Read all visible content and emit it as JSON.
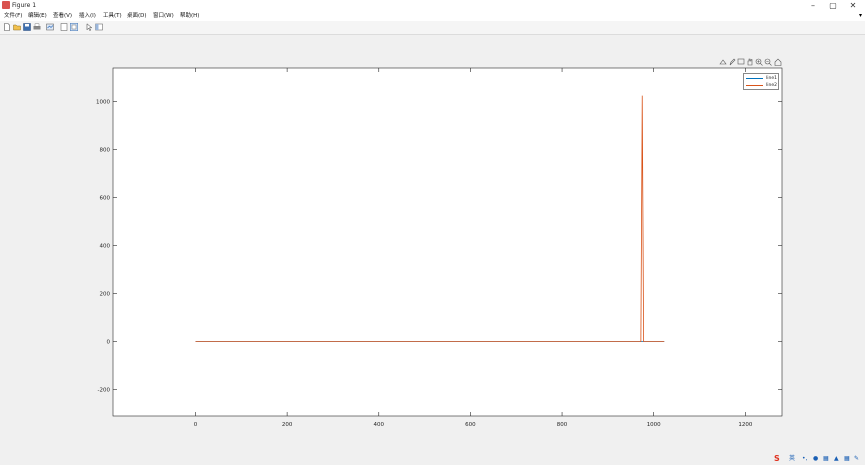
{
  "window": {
    "title": "Figure 1"
  },
  "menu": [
    "文件(F)",
    "编辑(E)",
    "查看(V)",
    "插入(I)",
    "工具(T)",
    "桌面(D)",
    "窗口(W)",
    "帮助(H)"
  ],
  "colors": {
    "line1": "#0072BD",
    "line2": "#D95319"
  },
  "chart_data": {
    "type": "line",
    "xlim": [
      -180,
      1280
    ],
    "ylim": [
      -310,
      1140
    ],
    "xticks": [
      0,
      200,
      400,
      600,
      800,
      1000,
      1200
    ],
    "yticks": [
      -200,
      0,
      200,
      400,
      600,
      800,
      1000
    ],
    "xticklabels": [
      "0",
      "200",
      "400",
      "600",
      "800",
      "1000",
      "1200"
    ],
    "yticklabels": [
      "-200",
      "0",
      "200",
      "400",
      "600",
      "800",
      "1000"
    ],
    "legend_placement": "top-right",
    "series": [
      {
        "name": "line1",
        "x": [
          0,
          1023
        ],
        "y": [
          0,
          0
        ]
      },
      {
        "name": "line2",
        "x": [
          0,
          972,
          975,
          978,
          1023
        ],
        "y": [
          0,
          0,
          1025,
          0,
          0
        ]
      }
    ]
  }
}
